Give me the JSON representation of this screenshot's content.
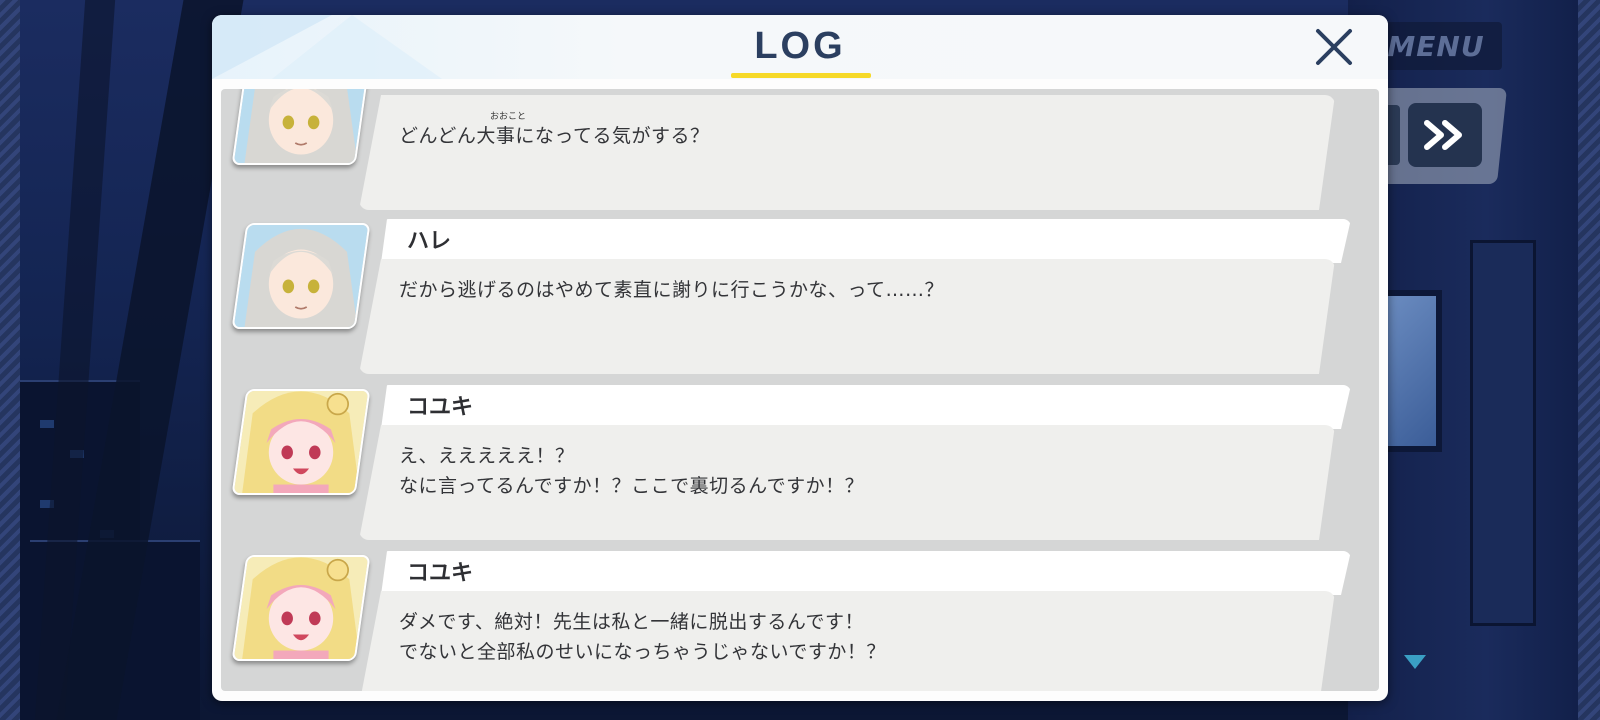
{
  "menu": {
    "label": "MENU"
  },
  "log": {
    "title": "LOG",
    "entries": [
      {
        "speaker": "",
        "ruby": "おおこと",
        "lines": [
          "どんどん大事になってる気がする？"
        ],
        "portrait": "hare"
      },
      {
        "speaker": "ハレ",
        "lines": [
          "だから逃げるのはやめて素直に謝りに行こうかな、って……？"
        ],
        "portrait": "hare"
      },
      {
        "speaker": "コユキ",
        "lines": [
          "え、えええええ！？",
          "なに言ってるんですか！？ここで裏切るんですか！？"
        ],
        "portrait": "koyuki"
      },
      {
        "speaker": "コユキ",
        "lines": [
          "ダメです、絶対！先生は私と一緒に脱出するんです！",
          "でないと全部私のせいになっちゃうじゃないですか！？"
        ],
        "portrait": "koyuki"
      }
    ]
  },
  "colors": {
    "accent_underline": "#f6d928",
    "title": "#2b3f60",
    "panel_body": "#d5d6d6",
    "bubble": "#efefed"
  },
  "icons": {
    "close": "close-icon",
    "fast_forward": "fast-forward-icon",
    "scroll_down": "chevron-down-icon"
  }
}
